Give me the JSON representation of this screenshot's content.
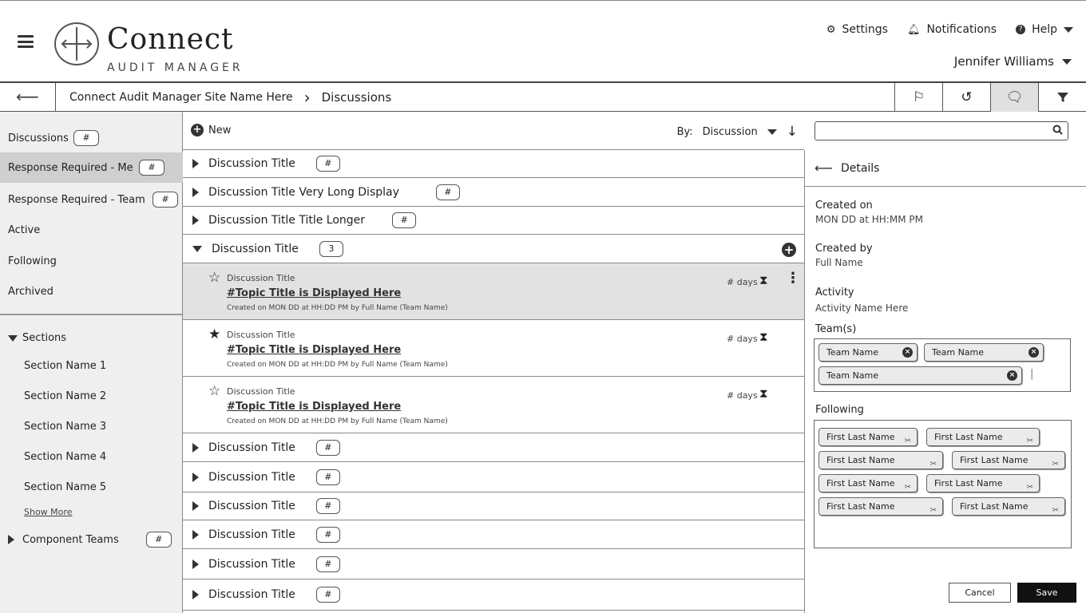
{
  "header": {
    "app_name": "Connect",
    "app_subtitle": "AUDIT MANAGER",
    "settings": "Settings",
    "notifications": "Notifications",
    "help": "Help",
    "user": "Jennifer Williams"
  },
  "breadcrumb": {
    "site": "Connect Audit Manager Site Name Here",
    "current": "Discussions"
  },
  "sidebar": {
    "items": [
      {
        "label": "Discussions",
        "badge": "#"
      },
      {
        "label": "Response Required - Me",
        "badge": "#"
      },
      {
        "label": "Response Required - Team",
        "badge": "#"
      },
      {
        "label": "Active"
      },
      {
        "label": "Following"
      },
      {
        "label": "Archived"
      }
    ],
    "sections_label": "Sections",
    "sections": [
      "Section Name 1",
      "Section Name 2",
      "Section Name 3",
      "Section Name 4",
      "Section Name 5"
    ],
    "show_more": "Show More",
    "component_teams": "Component Teams",
    "component_teams_badge": "#"
  },
  "toolbar": {
    "new_label": "New",
    "sort_by": "By:",
    "sort_value": "Discussion"
  },
  "discussions": [
    {
      "title": "Discussion Title",
      "badge": "#"
    },
    {
      "title": "Discussion Title Very Long Display",
      "badge": "#"
    },
    {
      "title": "Discussion Title Title Longer",
      "badge": "#"
    },
    {
      "title": "Discussion Title",
      "badge": "3"
    },
    {
      "title": "Discussion Title",
      "badge": "#"
    },
    {
      "title": "Discussion Title",
      "badge": "#"
    },
    {
      "title": "Discussion Title",
      "badge": "#"
    },
    {
      "title": "Discussion Title",
      "badge": "#"
    },
    {
      "title": "Discussion Title",
      "badge": "#"
    },
    {
      "title": "Discussion Title",
      "badge": "#"
    }
  ],
  "topics": [
    {
      "kicker": "Discussion Title",
      "topic": "#Topic Title is Displayed Here",
      "meta": "Created on MON DD at HH:DD PM by Full Name (Team Name)",
      "days": "# days",
      "starred": false
    },
    {
      "kicker": "Discussion Title",
      "topic": "#Topic Title is Displayed Here",
      "meta": "Created on MON DD at HH:DD PM by Full Name (Team Name)",
      "days": "# days",
      "starred": true
    },
    {
      "kicker": "Discussion Title",
      "topic": "#Topic Title is Displayed Here",
      "meta": "Created on MON DD at HH:DD PM by Full Name (Team Name)",
      "days": "# days",
      "starred": false
    }
  ],
  "details": {
    "heading": "Details",
    "created_on_label": "Created on",
    "created_on_value": "MON DD at HH:MM PM",
    "created_by_label": "Created by",
    "created_by_value": "Full Name",
    "activity_label": "Activity",
    "activity_value": "Activity Name Here",
    "teams_label": "Team(s)",
    "teams": [
      "Team Name",
      "Team Name",
      "Team Name"
    ],
    "following_label": "Following",
    "following": [
      "First Last Name",
      "First Last Name",
      "First Last Name",
      "First Last Name",
      "First Last Name",
      "First Last Name",
      "First Last Name",
      "First Last Name"
    ],
    "cancel": "Cancel",
    "save": "Save"
  }
}
